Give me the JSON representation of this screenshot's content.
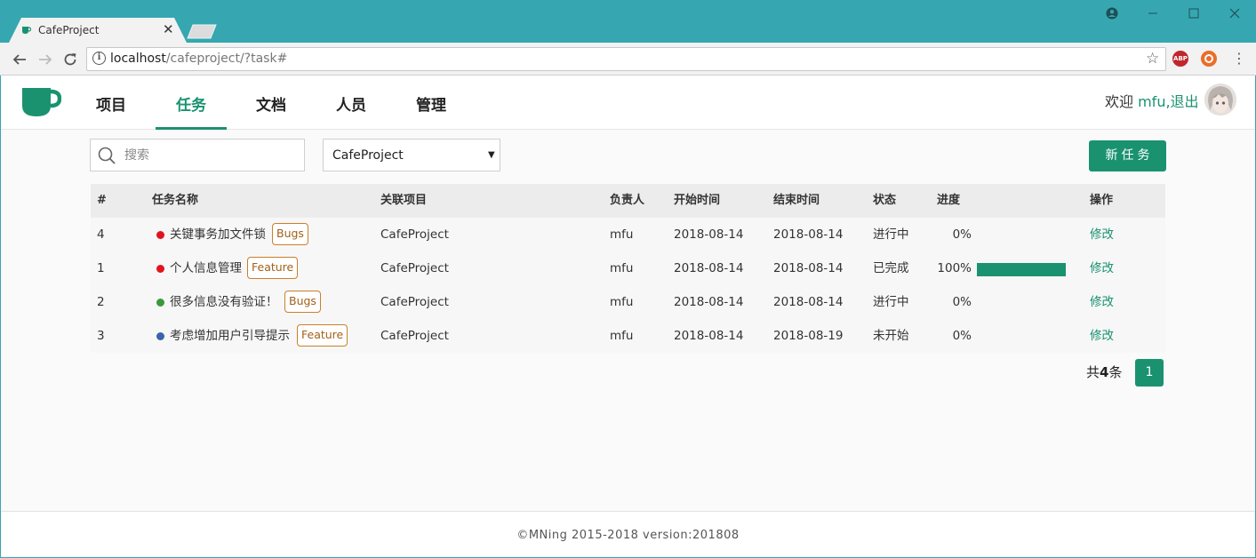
{
  "browser": {
    "tab_title": "CafeProject",
    "url_host": "localhost",
    "url_path": "/cafeproject/?task#"
  },
  "nav": {
    "items": [
      {
        "label": "项目",
        "active": false
      },
      {
        "label": "任务",
        "active": true
      },
      {
        "label": "文档",
        "active": false
      },
      {
        "label": "人员",
        "active": false
      },
      {
        "label": "管理",
        "active": false
      }
    ]
  },
  "user": {
    "welcome_prefix": "欢迎 ",
    "name": "mfu",
    "separator": ",",
    "logout": "退出"
  },
  "toolbar": {
    "search_placeholder": "搜索",
    "project_select": "CafeProject",
    "new_task_label": "新任务"
  },
  "table": {
    "headers": {
      "id": "#",
      "name": "任务名称",
      "project": "关联项目",
      "owner": "负责人",
      "start": "开始时间",
      "end": "结束时间",
      "status": "状态",
      "progress": "进度",
      "action": "操作"
    },
    "rows": [
      {
        "id": "4",
        "name": "关键事务加文件锁",
        "dot_color": "#e0141e",
        "tag": "Bugs",
        "project": "CafeProject",
        "owner": "mfu",
        "start": "2018-08-14",
        "end": "2018-08-14",
        "status": "进行中",
        "progress_label": "0%",
        "progress": 0,
        "action": "修改"
      },
      {
        "id": "1",
        "name": "个人信息管理",
        "dot_color": "#e0141e",
        "tag": "Feature",
        "project": "CafeProject",
        "owner": "mfu",
        "start": "2018-08-14",
        "end": "2018-08-14",
        "status": "已完成",
        "progress_label": "100%",
        "progress": 100,
        "action": "修改"
      },
      {
        "id": "2",
        "name": "很多信息没有验证！",
        "dot_color": "#3a9a3a",
        "tag": "Bugs",
        "project": "CafeProject",
        "owner": "mfu",
        "start": "2018-08-14",
        "end": "2018-08-14",
        "status": "进行中",
        "progress_label": "0%",
        "progress": 0,
        "action": "修改"
      },
      {
        "id": "3",
        "name": "考虑增加用户引导提示",
        "dot_color": "#3a64a8",
        "tag": "Feature",
        "project": "CafeProject",
        "owner": "mfu",
        "start": "2018-08-14",
        "end": "2018-08-19",
        "status": "未开始",
        "progress_label": "0%",
        "progress": 0,
        "action": "修改"
      }
    ]
  },
  "pagination": {
    "total_prefix": "共",
    "total_count": "4",
    "total_suffix": "条",
    "current_page": "1"
  },
  "footer": {
    "text": "©MNing 2015-2018  version:201808"
  },
  "colors": {
    "accent": "#1a9270",
    "titlebar": "#36a7b1"
  }
}
